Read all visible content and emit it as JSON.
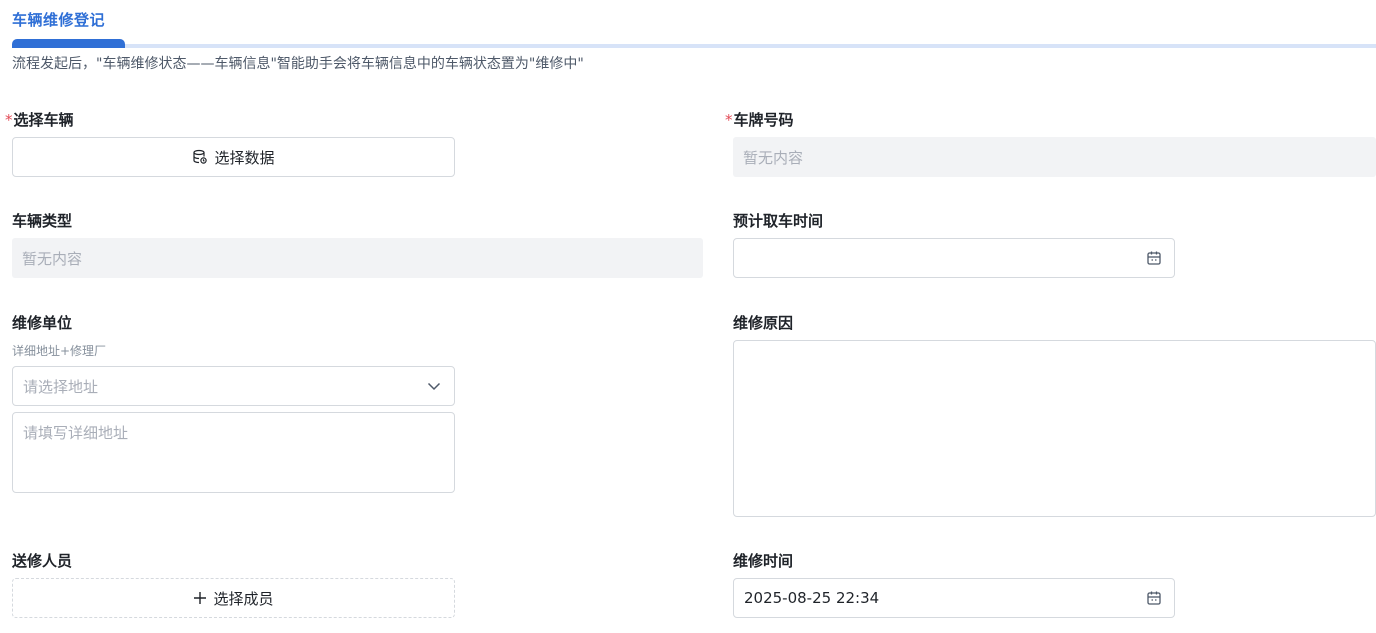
{
  "header": {
    "title": "车辆维修登记",
    "description": "流程发起后，\"车辆维修状态——车辆信息\"智能助手会将车辆信息中的车辆状态置为\"维修中\""
  },
  "colors": {
    "accent": "#2f6fd6",
    "required": "#e34d59"
  },
  "fields": {
    "vehicle": {
      "required_mark": "*",
      "label": "选择车辆",
      "button_label": "选择数据",
      "button_icon": "database-icon"
    },
    "plate": {
      "required_mark": "*",
      "label": "车牌号码",
      "value": "暂无内容"
    },
    "vehicle_type": {
      "label": "车辆类型",
      "value": "暂无内容"
    },
    "pickup_time": {
      "label": "预计取车时间",
      "value": "",
      "icon": "calendar-icon"
    },
    "repair_unit": {
      "label": "维修单位",
      "hint": "详细地址+修理厂",
      "select_placeholder": "请选择地址",
      "detail_placeholder": "请填写详细地址",
      "select_icon": "chevron-down-icon"
    },
    "repair_reason": {
      "label": "维修原因",
      "value": ""
    },
    "sender": {
      "label": "送修人员",
      "button_label": "选择成员",
      "button_icon": "plus-icon"
    },
    "repair_time": {
      "label": "维修时间",
      "value": "2025-08-25 22:34",
      "icon": "calendar-icon"
    }
  }
}
